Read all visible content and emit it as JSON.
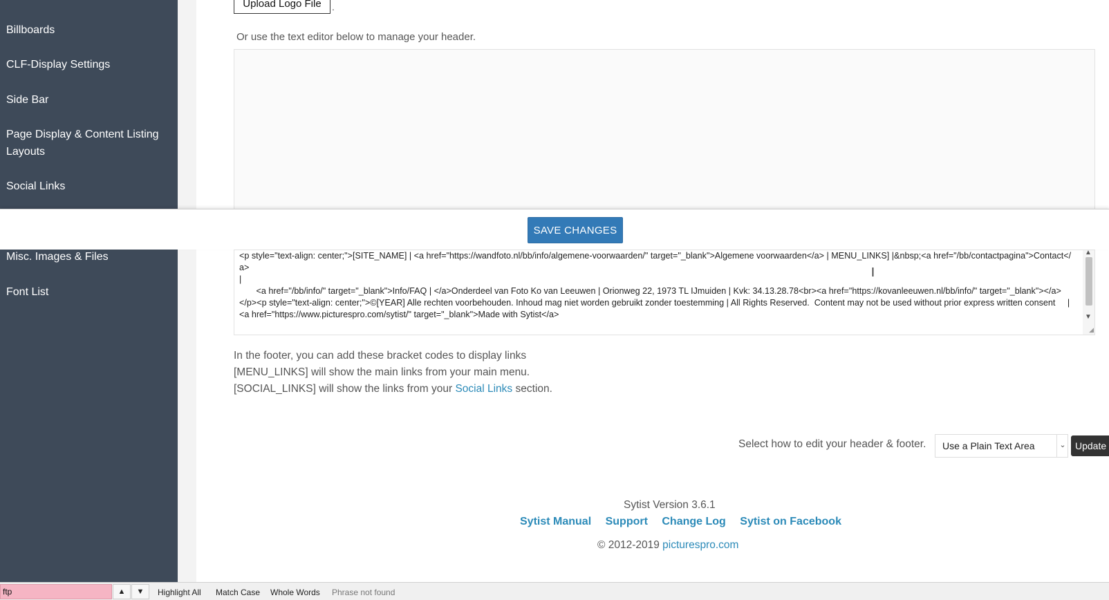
{
  "sidebar": {
    "items": [
      {
        "label": "Billboards"
      },
      {
        "label": "CLF-Display Settings"
      },
      {
        "label": "Side Bar"
      },
      {
        "label": "Page Display & Content Listing Layouts"
      },
      {
        "label": "Social Links"
      },
      {
        "label": "Misc. Images & Files"
      },
      {
        "label": "Font List"
      }
    ]
  },
  "header_editor": {
    "upload_label": "Upload Logo File",
    "hint": "Or use the text editor below to manage your header."
  },
  "save_bar": {
    "save_label": "SAVE CHANGES"
  },
  "footer_editor": {
    "code": "<p style=\"text-align: center;\">[SITE_NAME] | <a href=\"https://wandfoto.nl/bb/info/algemene-voorwaarden/\" target=\"_blank\">Algemene voorwaarden</a> | MENU_LINKS] |&nbsp;<a href=\"/bb/contactpagina\">Contact</a>\n|\n       <a href=\"/bb/info/\" target=\"_blank\">Info/FAQ | </a>Onderdeel van Foto Ko van Leeuwen | Orionweg 22, 1973 TL IJmuiden | Kvk: 34.13.28.78<br><a href=\"https://kovanleeuwen.nl/bb/info/\" target=\"_blank\"></a>\n</p><p style=\"text-align: center;\">©[YEAR] Alle rechten voorbehouden. Inhoud mag niet worden gebruikt zonder toestemming | All Rights Reserved.  Content may not be used without prior express written consent     | <a href=\"https://www.picturespro.com/sytist/\" target=\"_blank\">Made with Sytist</a>"
  },
  "info": {
    "line1": "In the footer, you can add these bracket codes to display links",
    "line2": "[MENU_LINKS] will show the main links from your main menu.",
    "line3_prefix": "[SOCIAL_LINKS] will show the links from your ",
    "line3_link": "Social Links",
    "line3_suffix": " section."
  },
  "editor_mode": {
    "label": "Select how to edit your header & footer.",
    "selected": "Use a Plain Text Area",
    "update_label": "Update"
  },
  "footer": {
    "version": "Sytist Version 3.6.1",
    "links": [
      "Sytist Manual",
      "Support",
      "Change Log",
      "Sytist on Facebook"
    ],
    "copyright_prefix": "© 2012-2019 ",
    "copyright_link": "picturespro.com"
  },
  "findbar": {
    "query": "ftp",
    "highlight_all": "Highlight All",
    "match_case": "Match Case",
    "whole_words": "Whole Words",
    "status": "Phrase not found"
  }
}
